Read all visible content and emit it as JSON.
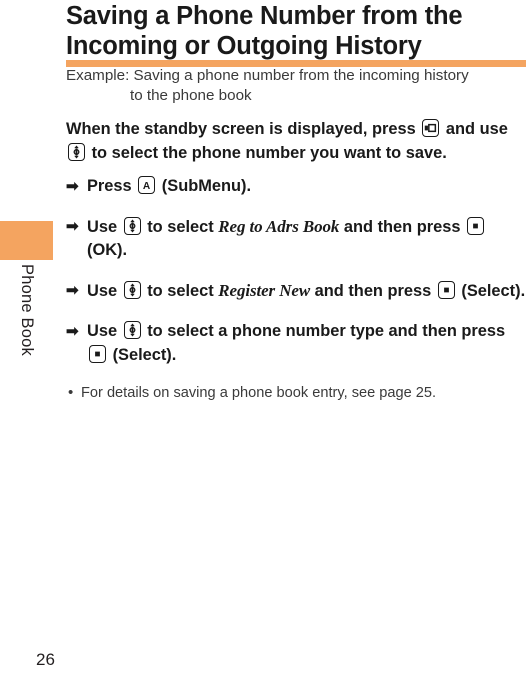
{
  "sidebar": {
    "tab_color": "#f4a460",
    "label": "Phone Book"
  },
  "heading": {
    "line1": "Saving a Phone Number from the",
    "line2": "Incoming or Outgoing History",
    "rule_color": "#f4a460"
  },
  "example": {
    "line1": "Example: Saving a phone number from the incoming history",
    "line2": "to the phone book"
  },
  "lead_paragraph": {
    "text_before_key": "When the standby screen is displayed, press",
    "key1": "softkey-right-icon",
    "text_middle": "and use",
    "key2": "navigation-updown-icon",
    "text_after": "to select the phone number you want to save."
  },
  "steps": [
    {
      "arrow": "➡",
      "text_before": "Press",
      "key": "submenu-a-key-icon",
      "text_after": "(SubMenu)."
    },
    {
      "arrow": "➡",
      "text_before": "Use",
      "key": "navigation-updown-icon",
      "text_middle": "to select",
      "italic": "Reg to Adrs Book",
      "text_middle2": "and then press",
      "key2": "ok-center-key-icon",
      "text_after": "(OK)."
    },
    {
      "arrow": "➡",
      "text_before": "Use",
      "key": "navigation-updown-icon",
      "text_middle": "to select",
      "italic": "Register New",
      "text_middle2": "and then press",
      "key2": "ok-center-key-icon",
      "text_after": "(Select)."
    },
    {
      "arrow": "➡",
      "text_before": "Use",
      "key": "navigation-updown-icon",
      "text_middle": "to select a phone number type and then press",
      "key2": "ok-center-key-icon",
      "text_after": "(Select)."
    }
  ],
  "subnote": {
    "bullet": "•",
    "text": "For details on saving a phone book entry, see page 25."
  },
  "page_number": "26"
}
